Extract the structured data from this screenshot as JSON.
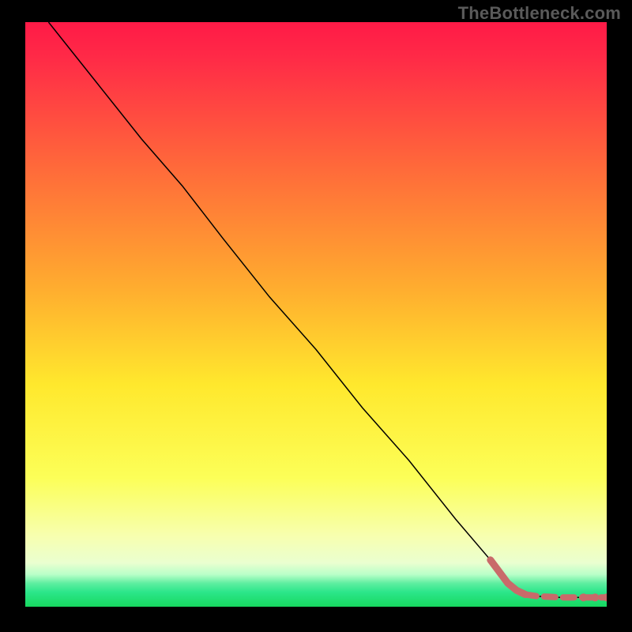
{
  "watermark": {
    "text": "TheBottleneck.com"
  },
  "chart_data": {
    "type": "line",
    "title": "",
    "xlabel": "",
    "ylabel": "",
    "xlim": [
      0,
      100
    ],
    "ylim": [
      0,
      100
    ],
    "background_gradient": {
      "top": "#ff1a47",
      "mid_upper": "#ff8a2b",
      "mid": "#ffe82d",
      "mid_lower": "#f7ffb0",
      "green_band": "#2ce68a",
      "bottom": "#17d85f"
    },
    "series": [
      {
        "name": "curve",
        "color": "#000000",
        "stroke_width": 1.5,
        "points": [
          {
            "x": 4,
            "y": 100
          },
          {
            "x": 12,
            "y": 90
          },
          {
            "x": 20,
            "y": 80
          },
          {
            "x": 27,
            "y": 72
          },
          {
            "x": 34,
            "y": 63
          },
          {
            "x": 42,
            "y": 53
          },
          {
            "x": 50,
            "y": 44
          },
          {
            "x": 58,
            "y": 34
          },
          {
            "x": 66,
            "y": 25
          },
          {
            "x": 74,
            "y": 15
          },
          {
            "x": 80,
            "y": 8
          },
          {
            "x": 84,
            "y": 3
          },
          {
            "x": 88,
            "y": 1.8
          },
          {
            "x": 92,
            "y": 1.6
          },
          {
            "x": 96,
            "y": 1.6
          },
          {
            "x": 100,
            "y": 1.6
          }
        ]
      },
      {
        "name": "highlight",
        "color": "#c96a6a",
        "marker_radius": 5,
        "dash": "8 5",
        "points": [
          {
            "x": 80,
            "y": 8
          },
          {
            "x": 81.5,
            "y": 6
          },
          {
            "x": 83,
            "y": 4
          },
          {
            "x": 84.5,
            "y": 2.8
          },
          {
            "x": 86,
            "y": 2.1
          },
          {
            "x": 88,
            "y": 1.8
          },
          {
            "x": 90,
            "y": 1.7
          },
          {
            "x": 92,
            "y": 1.6
          },
          {
            "x": 94,
            "y": 1.6
          },
          {
            "x": 96,
            "y": 1.6
          },
          {
            "x": 98,
            "y": 1.6
          },
          {
            "x": 100,
            "y": 1.6
          }
        ]
      }
    ]
  }
}
